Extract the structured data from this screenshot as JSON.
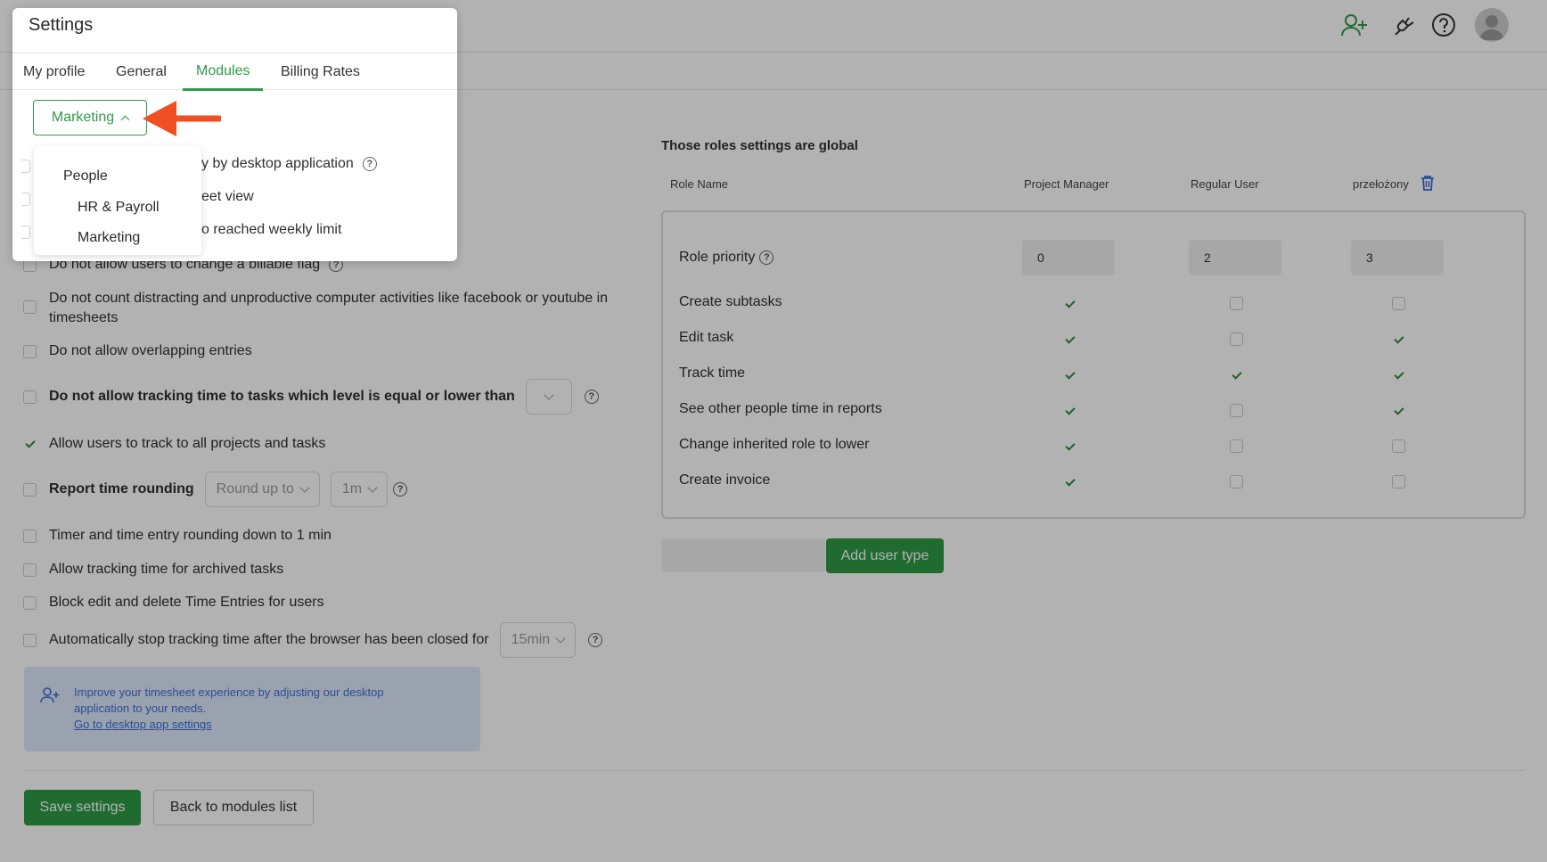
{
  "topbar": {
    "icons": [
      "add-user-icon",
      "plug-icon",
      "help-icon",
      "avatar"
    ]
  },
  "settings_rows": [
    {
      "label": "Do not allow users to change a billable flag",
      "checked": false,
      "help": true
    },
    {
      "label": "Do not count distracting and unproductive computer activities like facebook or youtube in timesheets",
      "checked": false
    },
    {
      "label": "Do not allow overlapping entries",
      "checked": false
    },
    {
      "label": "Do not allow tracking time to tasks which level is equal or lower than",
      "checked": false,
      "help": true
    },
    {
      "label": "Allow users to track to all projects and tasks",
      "checked": true
    },
    {
      "label": "Report time rounding",
      "checked": false,
      "help": true
    },
    {
      "label": "Timer and time entry rounding down to 1 min",
      "checked": false
    },
    {
      "label": "Allow tracking time for archived tasks",
      "checked": false
    },
    {
      "label": "Block edit and delete Time Entries for users",
      "checked": false
    },
    {
      "label": "Automatically stop tracking time after the browser has been closed for",
      "checked": false,
      "help": true
    }
  ],
  "rounding": {
    "mode": "Round up to",
    "interval": "1m"
  },
  "autostop": {
    "value": "15min"
  },
  "info": {
    "text": "Improve your timesheet experience by adjusting our desktop application to your needs.",
    "link": "Go to desktop app settings"
  },
  "roles": {
    "heading": "Those roles settings are global",
    "columns": [
      "Role Name",
      "Project Manager",
      "Regular User",
      "przełożony"
    ],
    "priority_label": "Role priority",
    "priorities": [
      "0",
      "2",
      "3"
    ],
    "permissions": [
      {
        "label": "Create subtasks",
        "values": [
          true,
          false,
          false
        ]
      },
      {
        "label": "Edit task",
        "values": [
          true,
          false,
          true
        ]
      },
      {
        "label": "Track time",
        "values": [
          true,
          true,
          true
        ]
      },
      {
        "label": "See other people time in reports",
        "values": [
          true,
          false,
          true
        ]
      },
      {
        "label": "Change inherited role to lower",
        "values": [
          true,
          false,
          false
        ]
      },
      {
        "label": "Create invoice",
        "values": [
          true,
          false,
          false
        ]
      }
    ],
    "add_button": "Add user type"
  },
  "footer": {
    "save": "Save settings",
    "back": "Back to modules list"
  },
  "modal": {
    "title": "Settings",
    "tabs": [
      "My profile",
      "General",
      "Modules",
      "Billing Rates"
    ],
    "active_tab": "Modules",
    "module_button": "Marketing",
    "dropdown": [
      "People",
      "HR & Payroll",
      "Marketing"
    ],
    "partial_rows": [
      "y by desktop application",
      "eet view",
      "o reached weekly limit"
    ]
  },
  "colors": {
    "accent": "#2f9b46",
    "arrow": "#f04e23",
    "link": "#3b6fd6"
  }
}
